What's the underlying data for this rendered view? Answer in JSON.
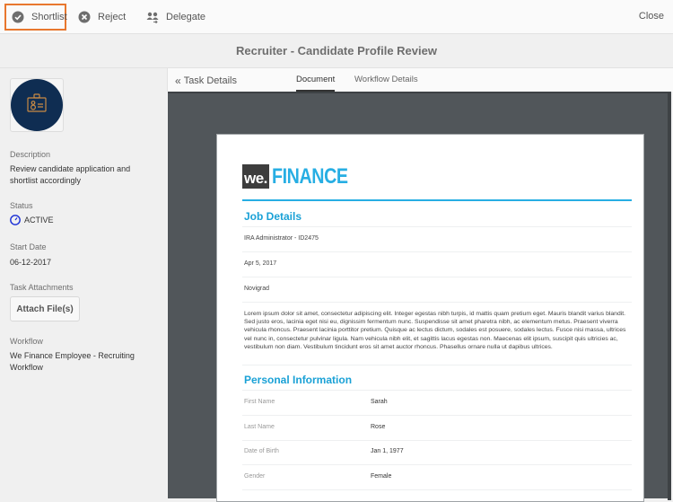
{
  "toolbar": {
    "shortlist": "Shortlist",
    "reject": "Reject",
    "delegate": "Delegate",
    "close": "Close",
    "highlight_color": "#e8772e"
  },
  "title": "Recruiter - Candidate Profile Review",
  "sidebar": {
    "avatar_icon": "id-badge-icon",
    "description_label": "Description",
    "description_value": "Review candidate application and shortlist accordingly",
    "status_label": "Status",
    "status_value": "ACTIVE",
    "start_date_label": "Start Date",
    "start_date_value": "06-12-2017",
    "attachments_label": "Task Attachments",
    "attach_button": "Attach File(s)",
    "workflow_label": "Workflow",
    "workflow_value": "We Finance Employee - Recruiting Workflow"
  },
  "tabs": {
    "back": "Task Details",
    "items": [
      {
        "label": "Document",
        "active": true
      },
      {
        "label": "Workflow Details",
        "active": false
      }
    ]
  },
  "document": {
    "logo_we": "we.",
    "logo_finance": "FINANCE",
    "brand_color": "#27aee3",
    "job_heading": "Job Details",
    "job_lines": [
      "IRA Administrator - ID2475",
      "Apr 5, 2017",
      "Novigrad"
    ],
    "lorem": "Lorem ipsum dolor sit amet, consectetur adipiscing elit. Integer egestas nibh turpis, id mattis quam pretium eget. Mauris blandit varius blandit. Sed justo eros, lacinia eget nisi eu, dignissim fermentum nunc. Suspendisse sit amet pharetra nibh, ac elementum metus. Praesent viverra vehicula rhoncus. Praesent lacinia porttitor pretium. Quisque ac lectus dictum, sodales est posuere, sodales lectus. Fusce nisi massa, ultrices vel nunc in, consectetur pulvinar ligula. Nam vehicula nibh elit, et sagittis lacus egestas non. Maecenas elit ipsum, suscipit quis ultricies ac, vestibulum non diam. Vestibulum tincidunt eros sit amet auctor rhoncus. Phasellus ornare nulla ut dapibus ultrices.",
    "personal_heading": "Personal Information",
    "fields": [
      {
        "label": "First Name",
        "value": "Sarah"
      },
      {
        "label": "Last Name",
        "value": "Rose"
      },
      {
        "label": "Date of Birth",
        "value": "Jan 1, 1977"
      },
      {
        "label": "Gender",
        "value": "Female"
      }
    ]
  }
}
